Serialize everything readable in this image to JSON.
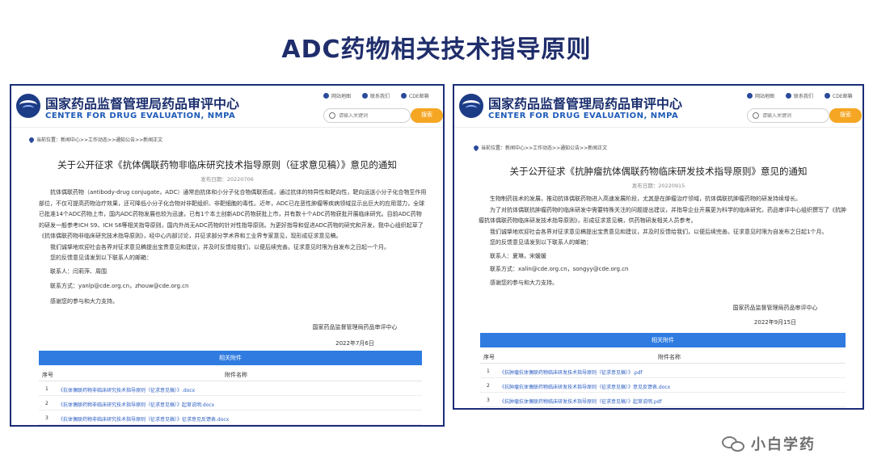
{
  "slide_title": "ADC药物相关技术指导原则",
  "left": {
    "header": {
      "org_cn": "国家药品监督管理局药品审评中心",
      "org_en": "CENTER FOR DRUG EVALUATION, NMPA",
      "links": [
        {
          "label": "网站地图",
          "icon": "sitemap-icon"
        },
        {
          "label": "联系我们",
          "icon": "phone-icon"
        },
        {
          "label": "CDE邮箱",
          "icon": "mail-icon"
        }
      ],
      "search_placeholder": "请输入关键词",
      "search_button": "搜索"
    },
    "breadcrumb": "当前位置：新闻中心>>工作动态>>通知公告>>新闻正文",
    "title": "关于公开征求《抗体偶联药物非临床研究技术指导原则（征求意见稿）》意见的通知",
    "publish_date": "发布日期：20220706",
    "paragraphs": [
      "抗体偶联药物（antibody-drug conjugate，ADC）通常由抗体和小分子化合物偶联而成，通过抗体的特异性和靶向性，靶向运送小分子化合物至作用部位，不仅可提高药物治疗效果，还可降低小分子化合物对非靶组织、非靶细胞的毒性。近年，ADC已在恶性肿瘤等疾病领域显示出巨大的应用潜力，全球已批准14个ADC药物上市，国内ADC药物发展也较为迅速，已有1个本土创新ADC药物获批上市，并有数十个ADC药物获批开展临床研究。目前ADC药物的研发一般参考ICH S9、ICH S6等相关指导原则，国内外尚无ADC药物的针对性指导原则。为更好指导和促进ADC药物的研究和开发，我中心组织起草了《抗体偶联药物非临床研究技术指导原则》，经中心内部讨论，并征求部分学术界和工业界专家意见，现形成征求意见稿。",
      "我们诚挚地欢迎社会各界对征求意见稿提出宝贵意见和建议，并及时反馈给我们，以便后续完善。征求意见时限为自发布之日起一个月。",
      "您的反馈意见请发到以下联系人的邮箱：",
      "联系人：闫莉萍、周围",
      "联系方式：yanlp@cde.org.cn，zhouw@cde.org.cn",
      "感谢您的参与和大力支持。"
    ],
    "signature_org": "国家药品监督管理局药品审评中心",
    "signature_date": "2022年7月6日",
    "attachments_title": "相关附件",
    "attachments_headers": {
      "num": "序号",
      "name": "附件名称"
    },
    "attachments": [
      {
        "num": "1",
        "name": "《抗体偶联药物非临床研究技术指导原则（征求意见稿）》.docx"
      },
      {
        "num": "2",
        "name": "《抗体偶联药物非临床研究技术指导原则（征求意见稿）》起草说明.docx"
      },
      {
        "num": "3",
        "name": "《抗体偶联药物非临床研究技术指导原则（征求意见稿）》征求意见反馈表.docx"
      }
    ]
  },
  "right": {
    "header": {
      "org_cn": "国家药品监督管理局药品审评中心",
      "org_en": "CENTER FOR DRUG EVALUATION, NMPA",
      "links": [
        {
          "label": "网站地图",
          "icon": "sitemap-icon"
        },
        {
          "label": "联系我们",
          "icon": "phone-icon"
        },
        {
          "label": "CDE邮箱",
          "icon": "mail-icon"
        }
      ],
      "search_placeholder": "请输入关键词",
      "search_button": "搜索"
    },
    "breadcrumb": "当前位置：新闻中心>>工作动态>>通知公告>>新闻正文",
    "title": "关于公开征求《抗肿瘤抗体偶联药物临床研发技术指导原则》意见的通知",
    "publish_date": "发布日期：20220915",
    "paragraphs": [
      "生物制药技术的发展，推动抗体偶联药物进入高速发展阶段，尤其是在肿瘤治疗领域，抗体偶联抗肿瘤药物的研发持续增长。",
      "为了对抗体偶联抗肿瘤药物的临床研发中需要特殊关注的问题提出建议，并指导企业开展更为科学的临床研究，药品审评中心组织撰写了《抗肿瘤抗体偶联药物临床研发技术指导原则》，形成征求意见稿，供药物研发相关人员参考。",
      "我们诚挚地欢迎社会各界对征求意见稿提出宝贵意见和建议，并及时反馈给我们，以便后续完善。征求意见时限为自发布之日起1个月。",
      "您的反馈意见请发到以下联系人的邮箱：",
      "联系人：夏琳，宋媛媛",
      "联系方式：xalin@cde.org.cn，songyy@cde.org.cn",
      "感谢您的参与和大力支持。"
    ],
    "signature_org": "国家药品监督管理局药品审评中心",
    "signature_date": "2022年9月15日",
    "attachments_title": "相关附件",
    "attachments_headers": {
      "num": "序号",
      "name": "附件名称"
    },
    "attachments": [
      {
        "num": "1",
        "name": "《抗肿瘤抗体偶联药物临床研发技术指导原则（征求意见稿）》.pdf"
      },
      {
        "num": "2",
        "name": "《抗肿瘤抗体偶联药物临床研发技术指导原则（征求意见稿）》意见反馈表.docx"
      },
      {
        "num": "3",
        "name": "《抗肿瘤抗体偶联药物临床研发技术指导原则（征求意见稿）》起草说明.pdf"
      }
    ]
  },
  "watermark": {
    "text": "小白学药",
    "icon": "wechat-icon"
  }
}
